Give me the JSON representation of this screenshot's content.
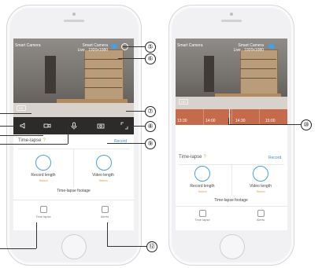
{
  "left_phone": {
    "camera_label": "Smart Camera",
    "camera_status": "Live · 1920x1080",
    "corner_tag": "Smart Camera",
    "hd_tag": "HD"
  },
  "right_phone": {
    "camera_label": "Smart Camera",
    "camera_status": "Live · 1920x1080",
    "corner_tag": "Smart Camera",
    "hd_tag": "HD",
    "timeline": {
      "times": [
        "13:30",
        "14:00",
        "14:30",
        "15:00"
      ]
    }
  },
  "timelapse": {
    "title": "Time-lapse",
    "record_label": "Record",
    "record_length_label": "Record length",
    "record_length_select": "Select",
    "video_length_label": "Video length",
    "video_length_select": "Select",
    "footage_label": "Time-lapse footage"
  },
  "tabs": {
    "timelapse": "Time lapse",
    "alerts": "Alerts"
  },
  "callouts": [
    "⑤",
    "⑥",
    "⑦",
    "⑧",
    "⑨",
    "⑩",
    "⑫"
  ],
  "colors": {
    "accent_blue": "#4a9fe0",
    "accent_orange": "#e39a3a",
    "timeline": "#c56a4b"
  }
}
